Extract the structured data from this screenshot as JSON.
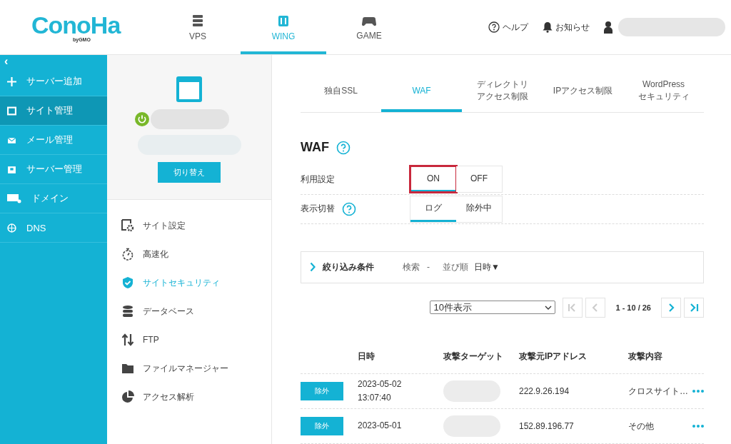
{
  "header": {
    "logo": {
      "name": "ConoHa",
      "sub": "byGMO"
    },
    "nav": [
      {
        "label": "VPS",
        "selected": false
      },
      {
        "label": "WING",
        "selected": true
      },
      {
        "label": "GAME",
        "selected": false
      }
    ],
    "links": [
      {
        "label": "ヘルプ"
      },
      {
        "label": "お知らせ"
      }
    ]
  },
  "sidebar": {
    "collapse": "‹",
    "items": [
      {
        "label": "サーバー追加",
        "selected": false
      },
      {
        "label": "サイト管理",
        "selected": true
      },
      {
        "label": "メール管理",
        "selected": false
      },
      {
        "label": "サーバー管理",
        "selected": false
      },
      {
        "label": "ドメイン",
        "selected": false
      },
      {
        "label": "DNS",
        "selected": false
      }
    ]
  },
  "site_panel": {
    "switch_button": "切り替え",
    "menu": [
      {
        "label": "サイト設定",
        "selected": false
      },
      {
        "label": "高速化",
        "selected": false
      },
      {
        "label": "サイトセキュリティ",
        "selected": true
      },
      {
        "label": "データベース",
        "selected": false
      },
      {
        "label": "FTP",
        "selected": false
      },
      {
        "label": "ファイルマネージャー",
        "selected": false
      },
      {
        "label": "アクセス解析",
        "selected": false
      }
    ]
  },
  "tabs": [
    {
      "lines": [
        "独自SSL"
      ],
      "selected": false
    },
    {
      "lines": [
        "WAF"
      ],
      "selected": true
    },
    {
      "lines": [
        "ディレクトリ",
        "アクセス制限"
      ],
      "selected": false
    },
    {
      "lines": [
        "IPアクセス制限"
      ],
      "selected": false
    },
    {
      "lines": [
        "WordPress",
        "セキュリティ"
      ],
      "selected": false
    }
  ],
  "section_title": "WAF",
  "settings": [
    {
      "label": "利用設定",
      "help": false,
      "options": [
        {
          "label": "ON",
          "selected": true,
          "highlighted": true
        },
        {
          "label": "OFF",
          "selected": false,
          "highlighted": false
        }
      ]
    },
    {
      "label": "表示切替",
      "help": true,
      "options": [
        {
          "label": "ログ",
          "selected": true,
          "highlighted": false
        },
        {
          "label": "除外中",
          "selected": false,
          "highlighted": false
        }
      ]
    }
  ],
  "filter": {
    "title": "絞り込み条件",
    "search_label": "検索",
    "search_value": "-",
    "sort_label": "並び順",
    "sort_value": "日時▼"
  },
  "pager": {
    "page_size": "10件表示",
    "range": "1 - 10 / 26"
  },
  "table": {
    "columns": [
      "日時",
      "攻撃ターゲット",
      "攻撃元IPアドレス",
      "攻撃内容"
    ],
    "rows": [
      {
        "action": "除外",
        "date": "2023-05-02",
        "time": "13:07:40",
        "ip": "222.9.26.194",
        "attack": "クロスサイト…"
      },
      {
        "action": "除外",
        "date": "2023-05-01",
        "ip": "152.89.196.77",
        "attack": "その他"
      }
    ]
  }
}
